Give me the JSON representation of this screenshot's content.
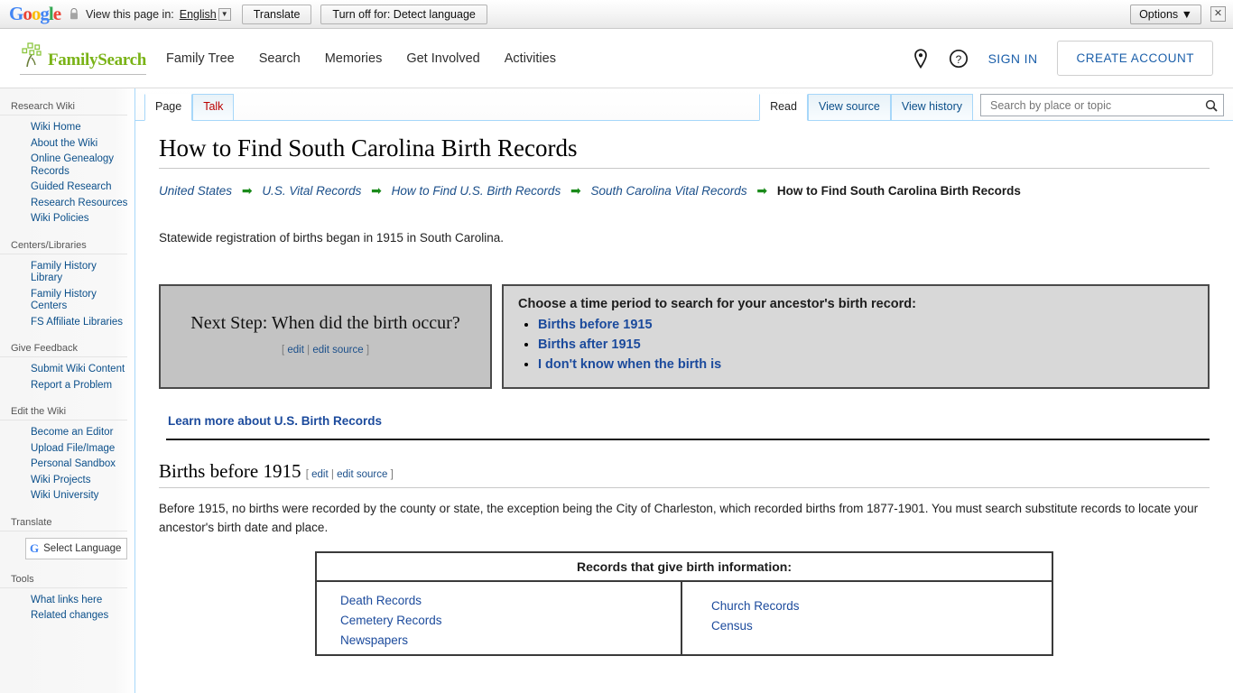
{
  "translate_bar": {
    "logo": "Google",
    "lock_icon": "lock-icon",
    "label": "View this page in:",
    "language": "English",
    "translate_button": "Translate",
    "turn_off_button": "Turn off for: Detect language",
    "options_button": "Options ▼",
    "close_icon": "✕"
  },
  "header": {
    "brand": "FamilySearch",
    "nav": [
      {
        "label": "Family Tree"
      },
      {
        "label": "Search"
      },
      {
        "label": "Memories"
      },
      {
        "label": "Get Involved"
      },
      {
        "label": "Activities"
      }
    ],
    "location_icon": "location-pin-icon",
    "help_icon": "help-circle-icon",
    "sign_in": "SIGN IN",
    "create_account": "CREATE ACCOUNT"
  },
  "sidebar": {
    "sections": [
      {
        "heading": "Research Wiki",
        "items": [
          "Wiki Home",
          "About the Wiki",
          "Online Genealogy Records",
          "Guided Research",
          "Research Resources",
          "Wiki Policies"
        ]
      },
      {
        "heading": "Centers/Libraries",
        "items": [
          "Family History Library",
          "Family History Centers",
          "FS Affiliate Libraries"
        ]
      },
      {
        "heading": "Give Feedback",
        "items": [
          "Submit Wiki Content",
          "Report a Problem"
        ]
      },
      {
        "heading": "Edit the Wiki",
        "items": [
          "Become an Editor",
          "Upload File/Image",
          "Personal Sandbox",
          "Wiki Projects",
          "Wiki University"
        ]
      },
      {
        "heading": "Translate",
        "items": []
      },
      {
        "heading": "Tools",
        "items": [
          "What links here",
          "Related changes"
        ]
      }
    ],
    "select_language": "Select Language",
    "google_g": "G"
  },
  "tabs": {
    "left": [
      {
        "label": "Page",
        "state": "active"
      },
      {
        "label": "Talk",
        "state": "newpage"
      }
    ],
    "right": [
      {
        "label": "Read",
        "state": "active"
      },
      {
        "label": "View source",
        "state": "normal"
      },
      {
        "label": "View history",
        "state": "normal"
      }
    ]
  },
  "search": {
    "placeholder": "Search by place or topic",
    "icon": "search-icon"
  },
  "main": {
    "title": "How to Find South Carolina Birth Records",
    "breadcrumb": [
      {
        "label": "United States",
        "current": false
      },
      {
        "label": "U.S. Vital Records",
        "current": false
      },
      {
        "label": "How to Find U.S. Birth Records",
        "current": false
      },
      {
        "label": "South Carolina Vital Records",
        "current": false
      },
      {
        "label": "How to Find South Carolina Birth Records",
        "current": true
      }
    ],
    "breadcrumb_arrow": "➡",
    "intro": "Statewide registration of births began in 1915 in South Carolina.",
    "next_step": {
      "title": "Next Step: When did the birth occur?",
      "edit": "edit",
      "edit_source": "edit source",
      "bracket_open": "[",
      "bracket_close": "]",
      "separator": "|"
    },
    "choose_box": {
      "title": "Choose a time period to search for your ancestor's birth record:",
      "options": [
        "Births before 1915",
        "Births after 1915",
        "I don't know when the birth is"
      ]
    },
    "learn_more": "Learn more about U.S. Birth Records",
    "section": {
      "title": "Births before 1915",
      "edit": "edit",
      "edit_source": "edit source",
      "paragraph": "Before 1915, no births were recorded by the county or state, the exception being the City of Charleston, which recorded births from 1877-1901. You must search substitute records to locate your ancestor's birth date and place."
    },
    "records_table": {
      "header": "Records that give birth information:",
      "column_left": [
        "Death Records",
        "Cemetery Records",
        "Newspapers"
      ],
      "column_right": [
        "Church Records",
        "Census"
      ]
    }
  },
  "colors": {
    "brand_green": "#7ab317",
    "link_blue": "#1b4a9c",
    "sidebar_link": "#0b4f8a",
    "breadcrumb_arrow_green": "#1a8a1a"
  }
}
